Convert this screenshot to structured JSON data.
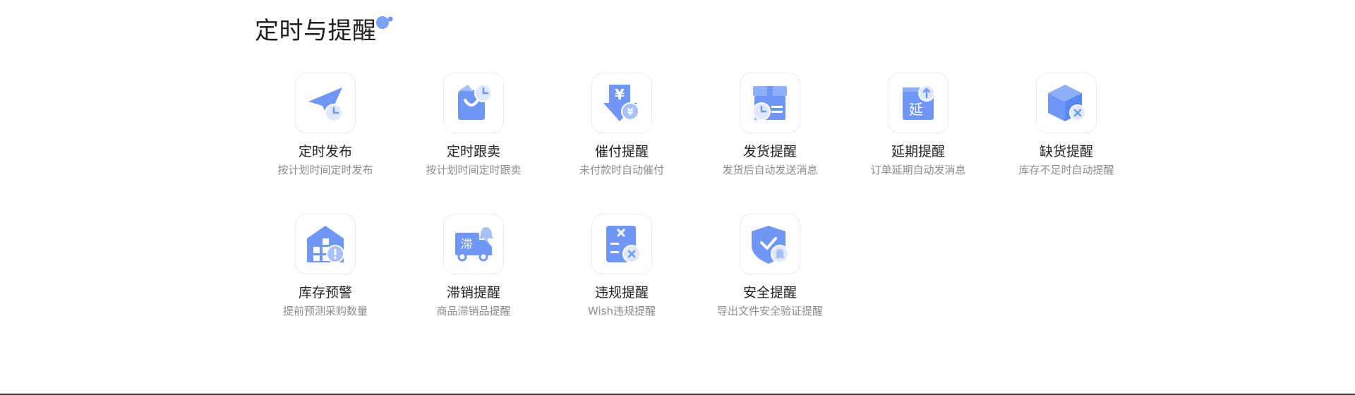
{
  "section": {
    "title": "定时与提醒"
  },
  "colors": {
    "accent": "#6e97f7",
    "accent_light": "#a9c1fb",
    "border": "#e6ecf6"
  },
  "features": [
    {
      "title": "定时发布",
      "desc": "按计划时间定时发布",
      "icon": "paper-plane-clock-icon"
    },
    {
      "title": "定时跟卖",
      "desc": "按计划时间定时跟卖",
      "icon": "shopping-bag-clock-icon"
    },
    {
      "title": "催付提醒",
      "desc": "未付款时自动催付",
      "icon": "yen-arrow-icon"
    },
    {
      "title": "发货提醒",
      "desc": "发货后自动发送消息",
      "icon": "package-clock-icon"
    },
    {
      "title": "延期提醒",
      "desc": "订单延期自动发消息",
      "icon": "calendar-extend-icon",
      "glyph": "延"
    },
    {
      "title": "缺货提醒",
      "desc": "库存不足时自动提醒",
      "icon": "cube-x-icon"
    },
    {
      "title": "库存预警",
      "desc": "提前预测采购数量",
      "icon": "warehouse-alert-icon"
    },
    {
      "title": "滞销提醒",
      "desc": "商品滞销品提醒",
      "icon": "truck-bell-icon",
      "glyph": "滞"
    },
    {
      "title": "违规提醒",
      "desc": "Wish违规提醒",
      "icon": "calculator-x-icon"
    },
    {
      "title": "安全提醒",
      "desc": "导出文件安全验证提醒",
      "icon": "shield-bell-icon"
    }
  ]
}
